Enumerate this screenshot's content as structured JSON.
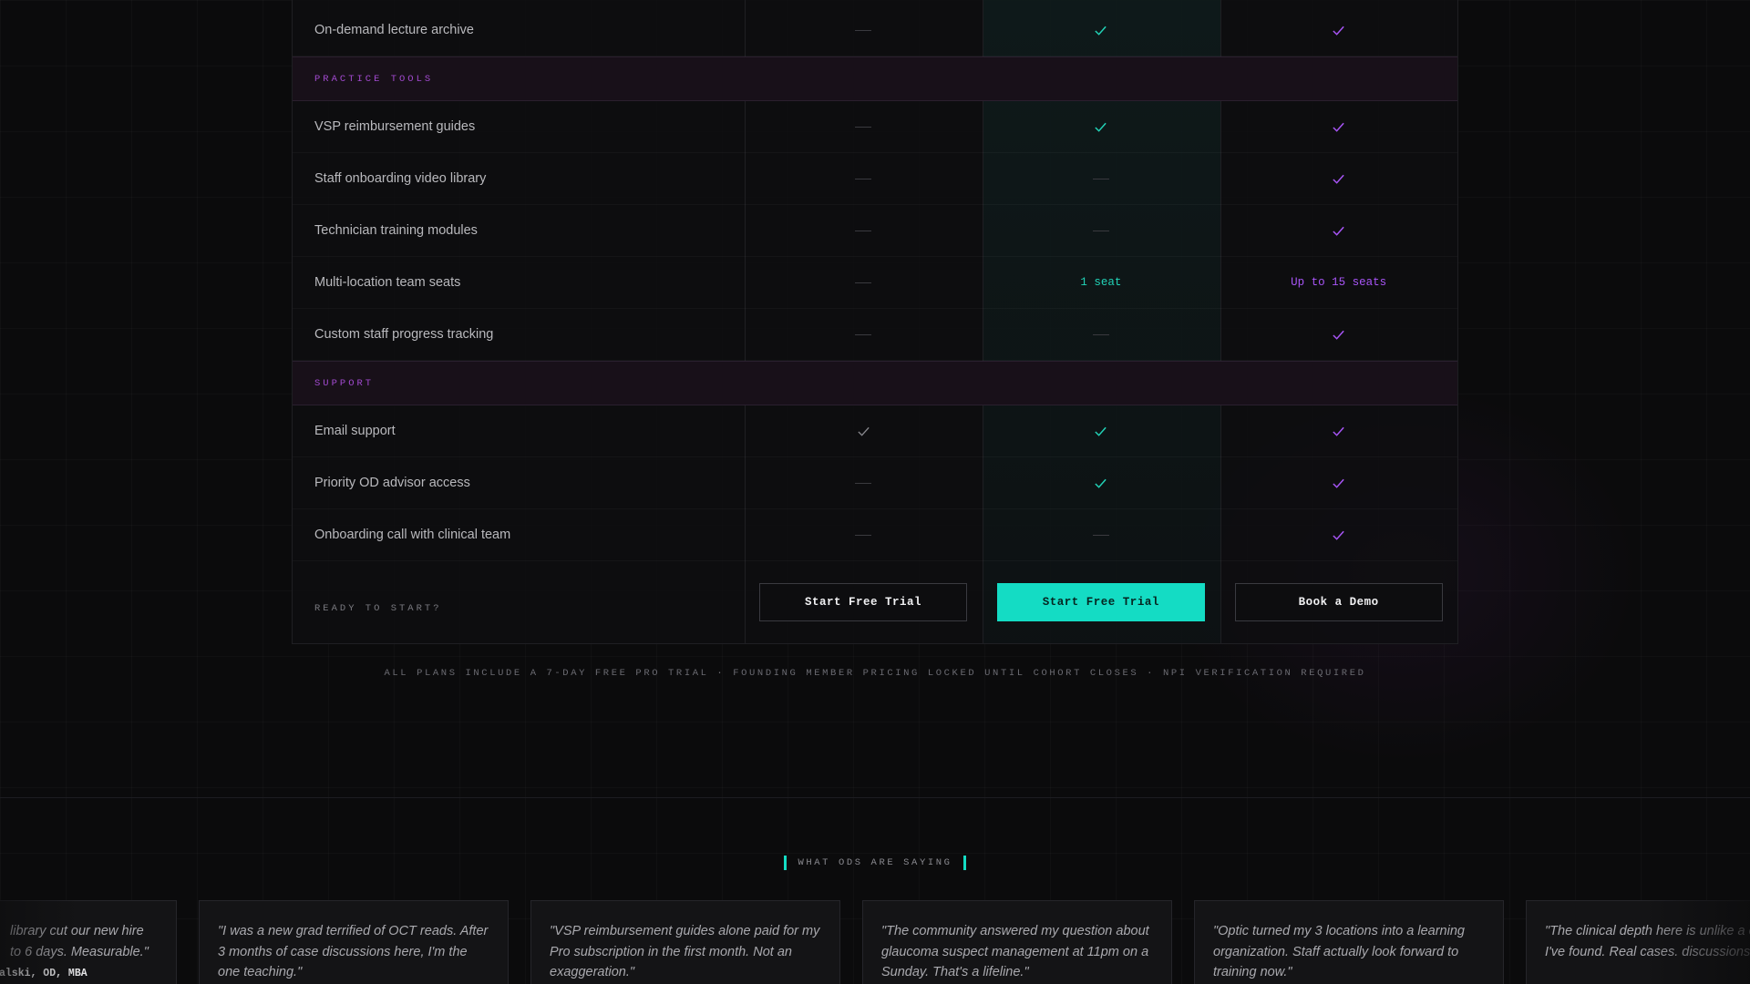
{
  "colors": {
    "teal": "#14dcc4",
    "purple": "#a855f7",
    "section_label": "#a24ad0",
    "background": "#0b0b0c"
  },
  "table": {
    "rows": [
      {
        "label": "On-demand lecture archive",
        "cells": [
          {
            "kind": "dash"
          },
          {
            "kind": "check",
            "color": "teal"
          },
          {
            "kind": "check",
            "color": "purple"
          }
        ]
      }
    ],
    "sections": [
      {
        "title": "PRACTICE TOOLS",
        "rows": [
          {
            "label": "VSP reimbursement guides",
            "cells": [
              {
                "kind": "dash"
              },
              {
                "kind": "check",
                "color": "teal"
              },
              {
                "kind": "check",
                "color": "purple"
              }
            ]
          },
          {
            "label": "Staff onboarding video library",
            "cells": [
              {
                "kind": "dash"
              },
              {
                "kind": "dash"
              },
              {
                "kind": "check",
                "color": "purple"
              }
            ]
          },
          {
            "label": "Technician training modules",
            "cells": [
              {
                "kind": "dash"
              },
              {
                "kind": "dash"
              },
              {
                "kind": "check",
                "color": "purple"
              }
            ]
          },
          {
            "label": "Multi-location team seats",
            "cells": [
              {
                "kind": "dash"
              },
              {
                "kind": "text",
                "color": "teal",
                "text": "1 seat"
              },
              {
                "kind": "text",
                "color": "purple",
                "text": "Up to 15 seats"
              }
            ]
          },
          {
            "label": "Custom staff progress tracking",
            "cells": [
              {
                "kind": "dash"
              },
              {
                "kind": "dash"
              },
              {
                "kind": "check",
                "color": "purple"
              }
            ]
          }
        ]
      },
      {
        "title": "SUPPORT",
        "rows": [
          {
            "label": "Email support",
            "cells": [
              {
                "kind": "check",
                "color": "gray"
              },
              {
                "kind": "check",
                "color": "teal"
              },
              {
                "kind": "check",
                "color": "purple"
              }
            ]
          },
          {
            "label": "Priority OD advisor access",
            "cells": [
              {
                "kind": "dash"
              },
              {
                "kind": "check",
                "color": "teal"
              },
              {
                "kind": "check",
                "color": "purple"
              }
            ]
          },
          {
            "label": "Onboarding call with clinical team",
            "cells": [
              {
                "kind": "dash"
              },
              {
                "kind": "dash"
              },
              {
                "kind": "check",
                "color": "purple"
              }
            ]
          }
        ]
      }
    ],
    "cta": {
      "label": "READY TO START?",
      "buttons": [
        "Start Free Trial",
        "Start Free Trial",
        "Book a Demo"
      ]
    }
  },
  "footnote": "ALL PLANS INCLUDE A 7-DAY FREE PRO TRIAL · FOUNDING MEMBER PRICING LOCKED UNTIL COHORT CLOSES · NPI VERIFICATION REQUIRED",
  "testimonials": {
    "eyebrow": "WHAT ODS ARE SAYING",
    "cards": [
      {
        "quote": "library cut our new hire to 6 days. Measurable.\"",
        "author": "alski, OD, MBA"
      },
      {
        "quote": "\"I was a new grad terrified of OCT reads. After 3 months of case discussions here, I'm the one teaching.\"",
        "author": ""
      },
      {
        "quote": "\"VSP reimbursement guides alone paid for my Pro subscription in the first month. Not an exaggeration.\"",
        "author": ""
      },
      {
        "quote": "\"The community answered my question about glaucoma suspect management at 11pm on a Sunday. That's a lifeline.\"",
        "author": ""
      },
      {
        "quote": "\"Optic turned my 3 locations into a learning organization. Staff actually look forward to training now.\"",
        "author": ""
      },
      {
        "quote": "\"The clinical depth here is unlike a community I've found. Real cases. discussions.\"",
        "author": ""
      }
    ]
  }
}
